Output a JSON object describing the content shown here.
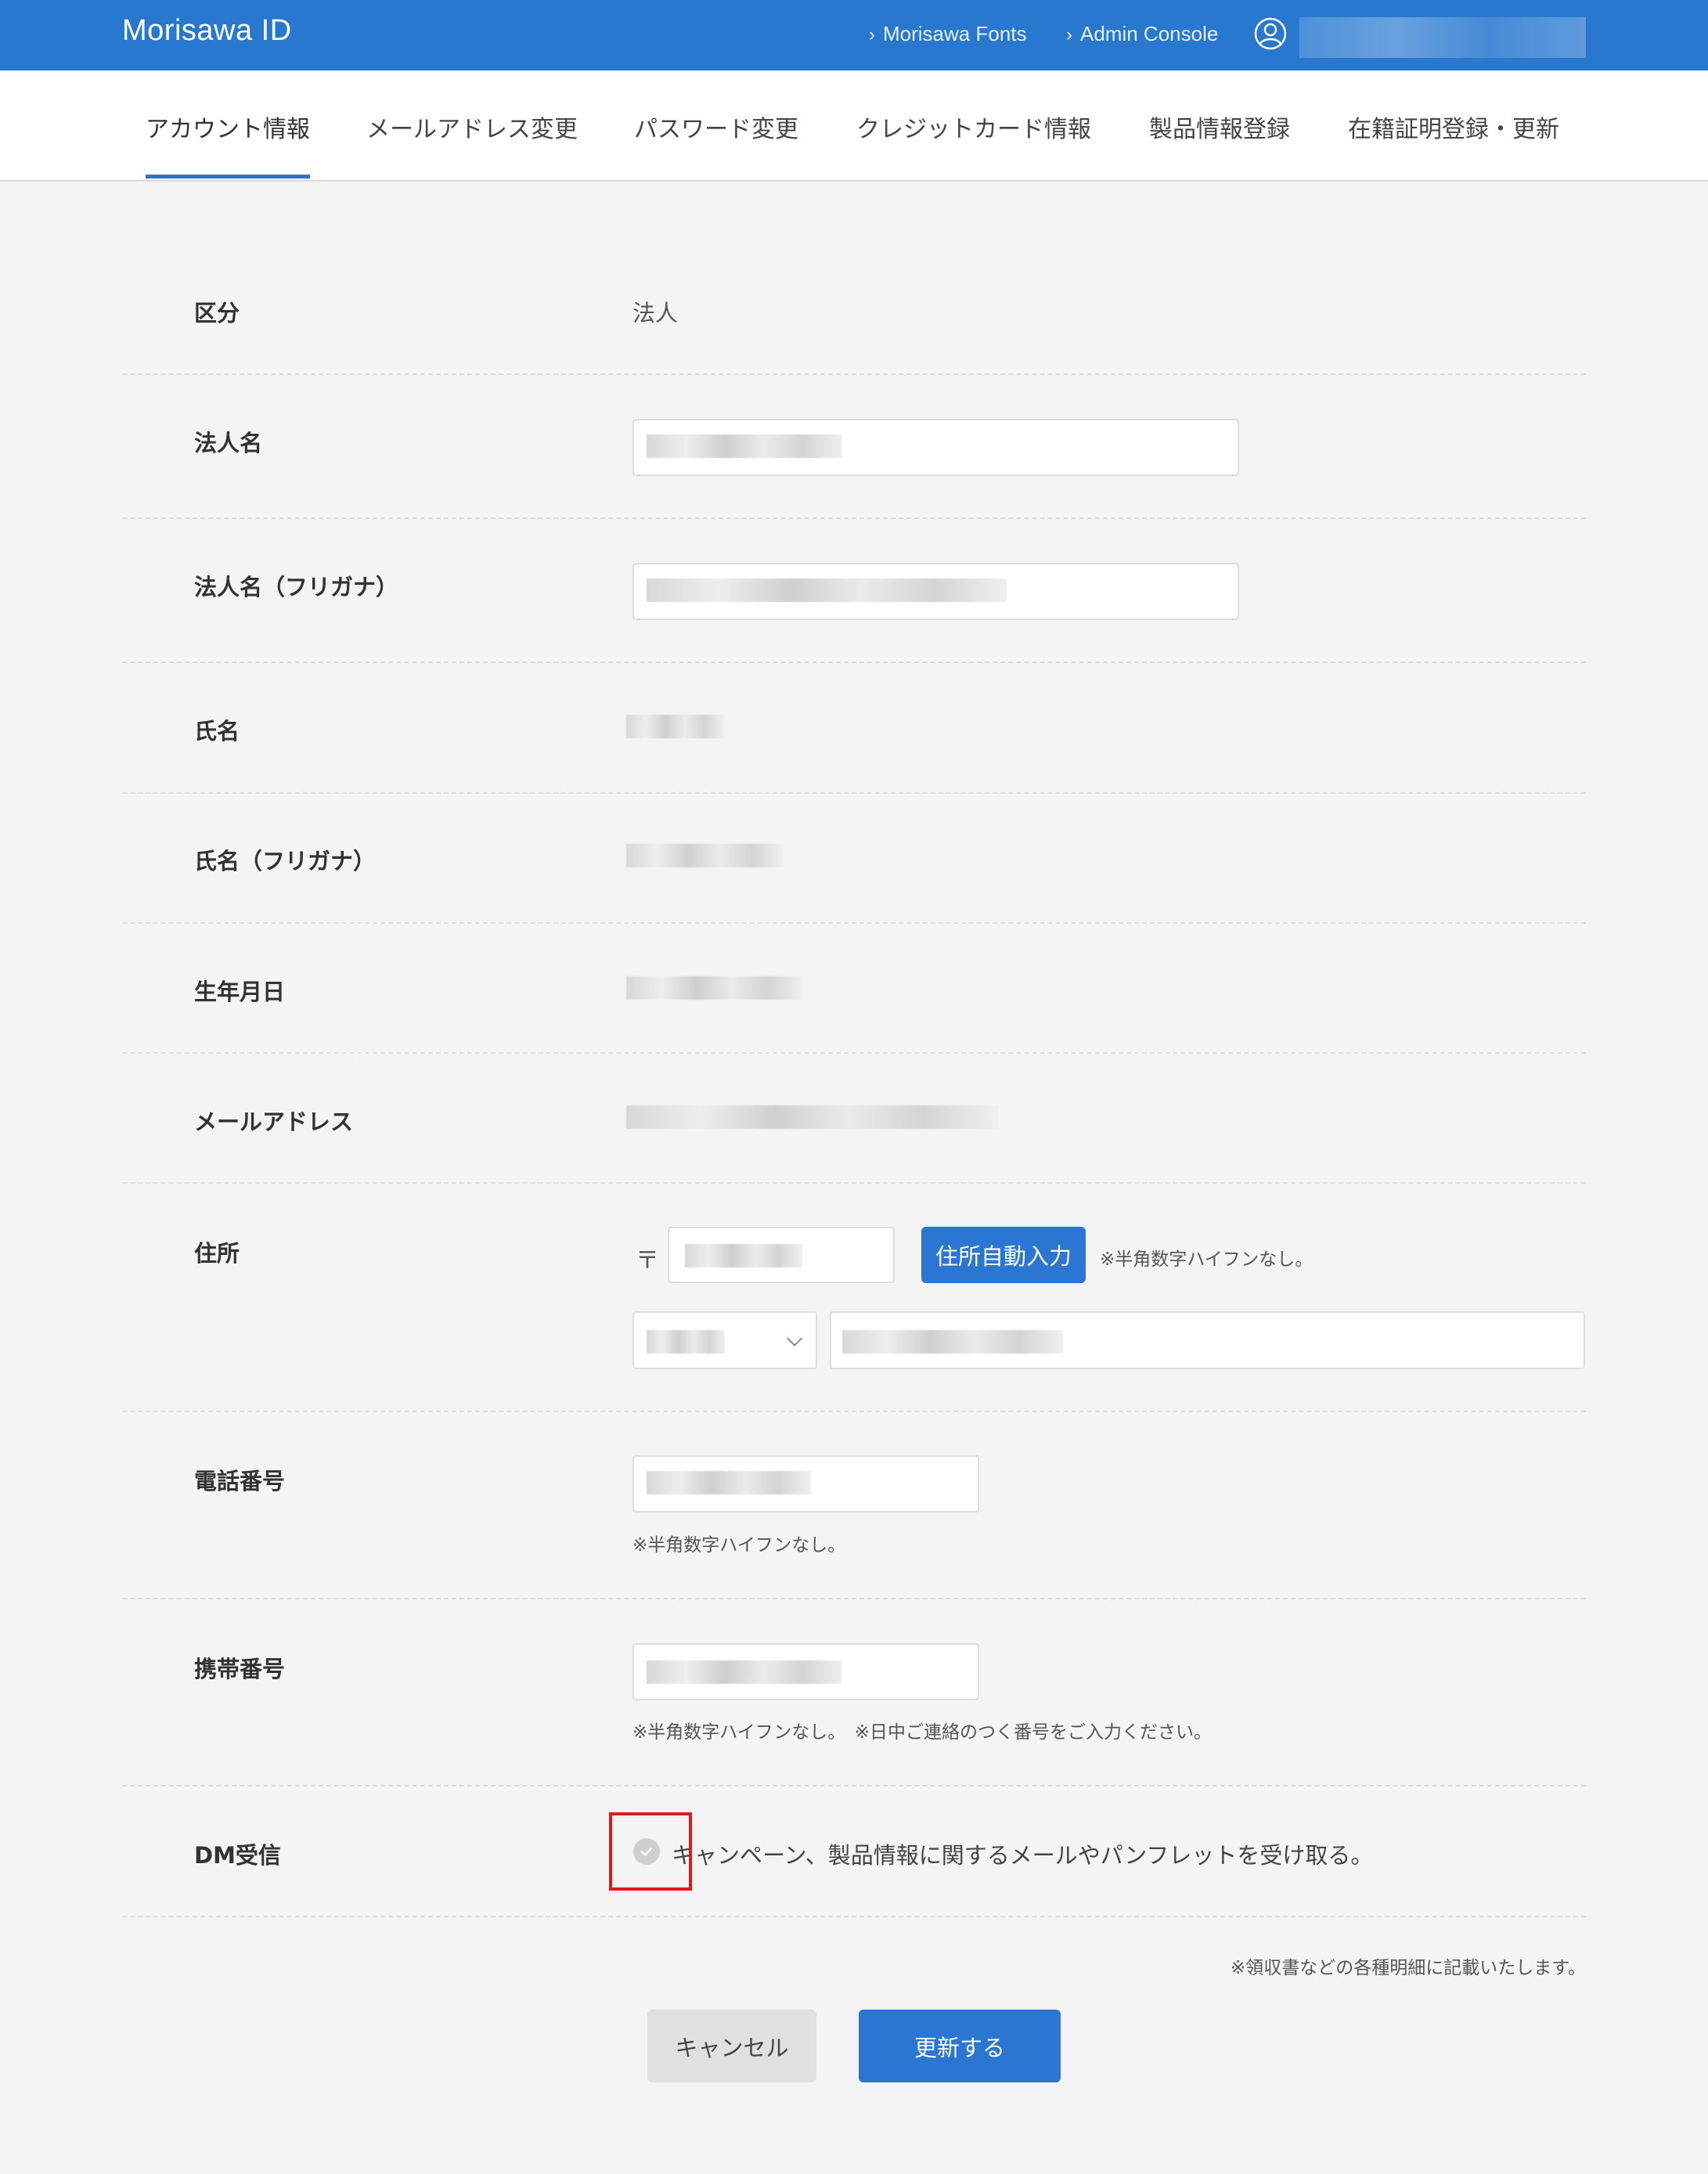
{
  "header": {
    "brand": "Morisawa ID",
    "links": [
      {
        "label": "Morisawa Fonts"
      },
      {
        "label": "Admin Console"
      }
    ],
    "bg_color": "#2878d0"
  },
  "tabs": [
    {
      "label": "アカウント情報",
      "active": true
    },
    {
      "label": "メールアドレス変更"
    },
    {
      "label": "パスワード変更"
    },
    {
      "label": "クレジットカード情報"
    },
    {
      "label": "製品情報登録"
    },
    {
      "label": "在籍証明登録・更新"
    }
  ],
  "form": {
    "category": {
      "label": "区分",
      "value": "法人"
    },
    "company_name": {
      "label": "法人名"
    },
    "company_kana": {
      "label": "法人名（フリガナ）"
    },
    "name": {
      "label": "氏名"
    },
    "name_kana": {
      "label": "氏名（フリガナ）"
    },
    "birthday": {
      "label": "生年月日"
    },
    "email": {
      "label": "メールアドレス"
    },
    "address": {
      "label": "住所",
      "postal_mark": "〒",
      "auto_fill_button": "住所自動入力",
      "postal_note": "※半角数字ハイフンなし。"
    },
    "phone": {
      "label": "電話番号",
      "note": "※半角数字ハイフンなし。"
    },
    "mobile": {
      "label": "携帯番号",
      "note": "※半角数字ハイフンなし。　※日中ご連絡のつく番号をご入力ください。"
    },
    "dm": {
      "label": "DM受信",
      "checkbox_label": "キャンペーン、製品情報に関するメールやパンフレットを受け取る。"
    }
  },
  "footer_note": "※領収書などの各種明細に記載いたします。",
  "buttons": {
    "cancel": "キャンセル",
    "submit": "更新する"
  }
}
